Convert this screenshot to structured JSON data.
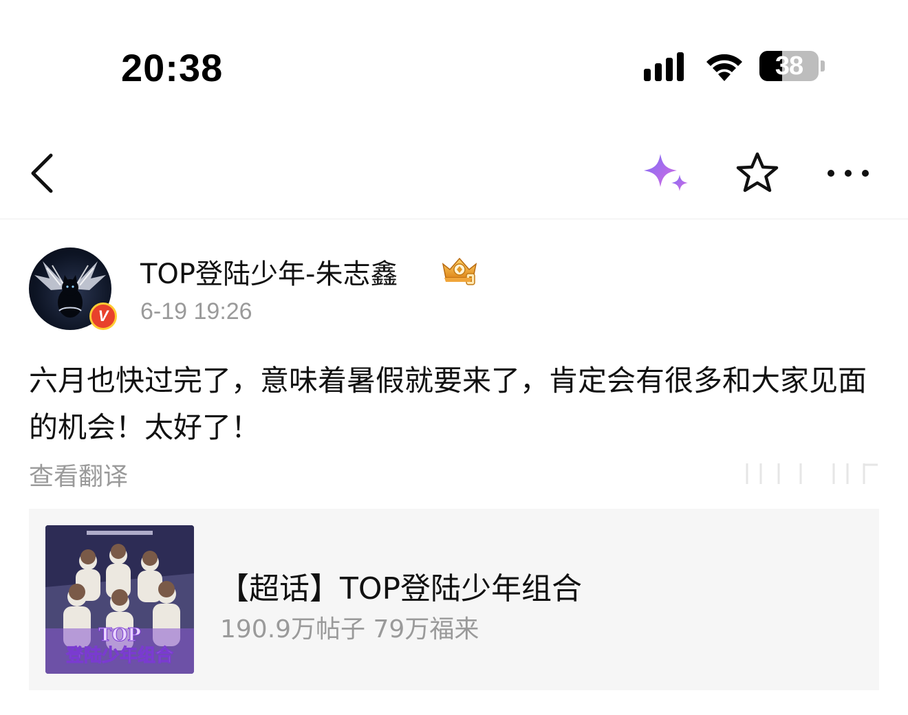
{
  "status_bar": {
    "time": "20:38",
    "battery_level": "38"
  },
  "nav": {
    "back_icon": "chevron-left-icon",
    "ai_icon": "sparkle-icon",
    "favorite_icon": "star-outline-icon",
    "more_icon": "more-dots-icon"
  },
  "post": {
    "author": "TOP登陆少年-朱志鑫",
    "verified_badge": "V",
    "time": "6-19 19:26",
    "text": "六月也快过完了，意味着暑假就要来了，肯定会有很多和大家见面的机会！太好了！",
    "translate_label": "查看翻译"
  },
  "topic": {
    "title": "【超话】TOP登陆少年组合",
    "stats": "190.9万帖子  79万福来"
  },
  "colors": {
    "secondary_text": "#9a9a9a",
    "card_bg": "#f6f6f6",
    "verified_red": "#e8412c",
    "sparkle_purple": "#9b6cf5"
  }
}
